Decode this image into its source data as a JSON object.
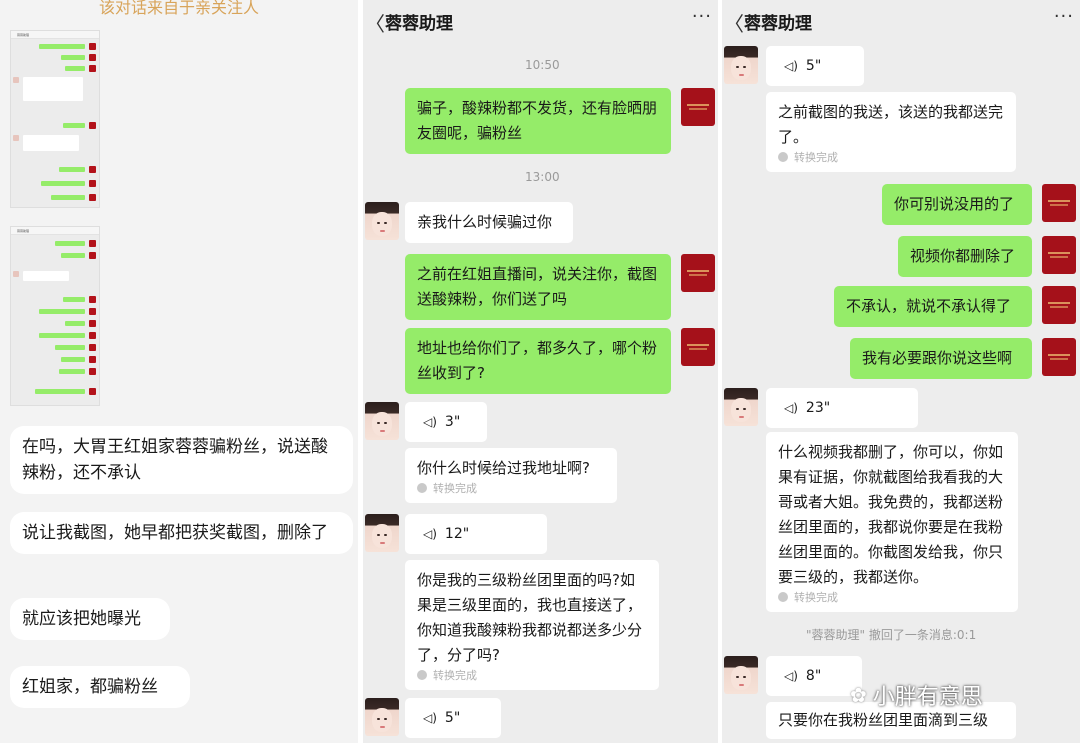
{
  "panel1": {
    "caption": "该对话来自于亲关注人",
    "thumb1_title": "蓉蓉助理",
    "thumb2_title": "蓉蓉助理",
    "messages": [
      "在吗，大胃王红姐家蓉蓉骗粉丝，说送酸辣粉，还不承认",
      "说让我截图，她早都把获奖截图，删除了",
      "就应该把她曝光",
      "红姐家，都骗粉丝"
    ]
  },
  "panel2": {
    "back": "〈",
    "title": "蓉蓉助理",
    "more": "···",
    "time1": "10:50",
    "time2": "13:00",
    "msg1": "骗子，酸辣粉都不发货，还有脸晒朋友圈呢，骗粉丝",
    "msg2": "亲我什么时候骗过你",
    "msg3": "之前在红姐直播间，说关注你，截图送酸辣粉，你们送了吗",
    "msg4": "地址也给你们了，都多久了，哪个粉丝收到了?",
    "voice1": "3\"",
    "msg5": "你什么时候给过我地址啊?",
    "conv": "转换完成",
    "voice2": "12\"",
    "msg6": "你是我的三级粉丝团里面的吗?如果是三级里面的，我也直接送了，你知道我酸辣粉我都说都送多少分了，分了吗?",
    "voice3": "5\""
  },
  "panel3": {
    "back": "〈",
    "title": "蓉蓉助理",
    "more": "···",
    "voice1": "5\"",
    "msg1": "之前截图的我送，该送的我都送完了。",
    "conv": "转换完成",
    "msg2": "你可别说没用的了",
    "msg3": "视频你都删除了",
    "msg4": "不承认，就说不承认得了",
    "msg5": "我有必要跟你说这些啊",
    "voice2": "23\"",
    "msg6": "什么视频我都删了，你可以，你如果有证据，你就截图给我看我的大哥或者大姐。我免费的，我都送粉丝团里面的，我都说你要是在我粉丝团里面的。你截图发给我，你只要三级的，我都送你。",
    "recall": "\"蓉蓉助理\" 撤回了一条消息:0:1",
    "voice3": "8\"",
    "msg7": "只要你在我粉丝团里面滴到三级"
  },
  "watermark": {
    "text": "小胖有意思"
  }
}
